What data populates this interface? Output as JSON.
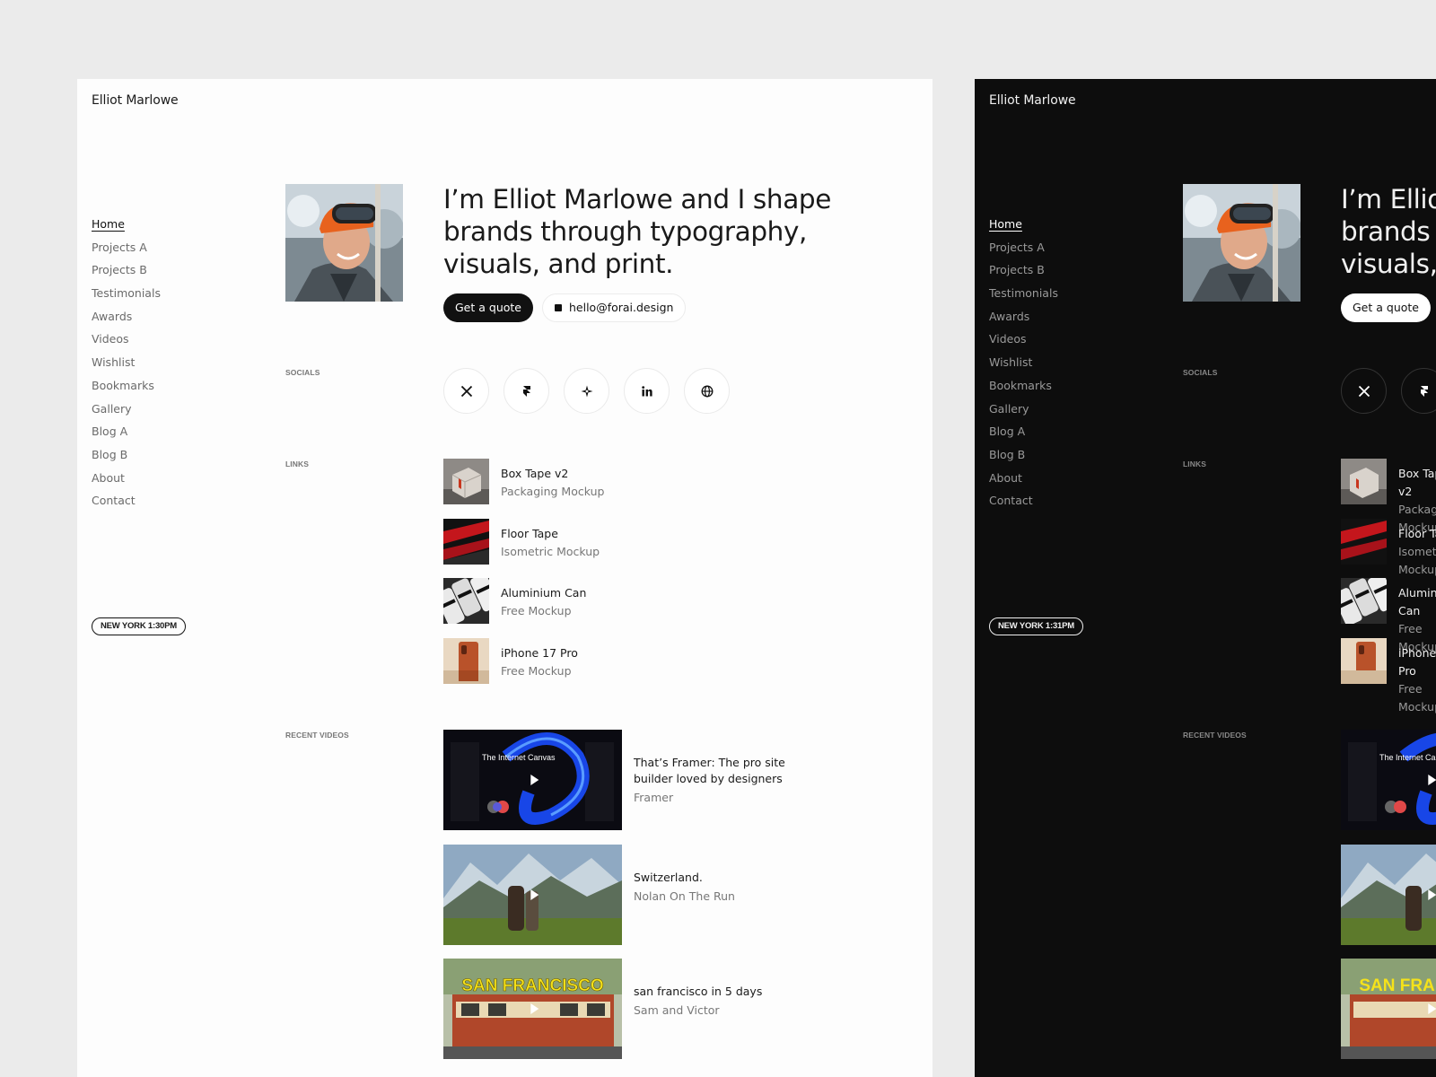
{
  "site": {
    "brand": "Elliot Marlowe",
    "nav": [
      "Home",
      "Projects A",
      "Projects B",
      "Testimonials",
      "Awards",
      "Videos",
      "Wishlist",
      "Bookmarks",
      "Gallery",
      "Blog A",
      "Blog B",
      "About",
      "Contact"
    ],
    "headline": "I’m Elliot Marlowe and I shape brands through typography, visuals, and print.",
    "quote_label": "Get a quote",
    "email": "hello@forai.design",
    "sections": {
      "socials": "SOCIALS",
      "links": "LINKS",
      "videos": "RECENT VIDEOS"
    },
    "socials": [
      {
        "icon": "x-icon"
      },
      {
        "icon": "framer-icon"
      },
      {
        "icon": "sparkle-icon"
      },
      {
        "icon": "linkedin-icon"
      },
      {
        "icon": "globe-icon"
      }
    ],
    "links": [
      {
        "title": "Box Tape v2",
        "subtitle": "Packaging Mockup"
      },
      {
        "title": "Floor Tape",
        "subtitle": "Isometric Mockup"
      },
      {
        "title": "Aluminium Can",
        "subtitle": "Free Mockup"
      },
      {
        "title": "iPhone 17 Pro",
        "subtitle": "Free Mockup"
      }
    ],
    "videos": [
      {
        "title": "That’s Framer: The pro site builder loved by designers",
        "channel": "Framer",
        "thumb_text": "The Internet Canvas"
      },
      {
        "title": "Switzerland.",
        "channel": "Nolan On The Run"
      },
      {
        "title": "san francisco in 5 days",
        "channel": "Sam and Victor",
        "thumb_text": "SAN FRANCISCO"
      }
    ]
  },
  "light_frame": {
    "time": "NEW YORK 1:30PM"
  },
  "dark_frame": {
    "time": "NEW YORK 1:31PM"
  },
  "colors": {
    "light_bg": "#fdfdfd",
    "dark_bg": "#0d0d0d",
    "page_bg": "#ebebeb",
    "accent": "#111111"
  }
}
